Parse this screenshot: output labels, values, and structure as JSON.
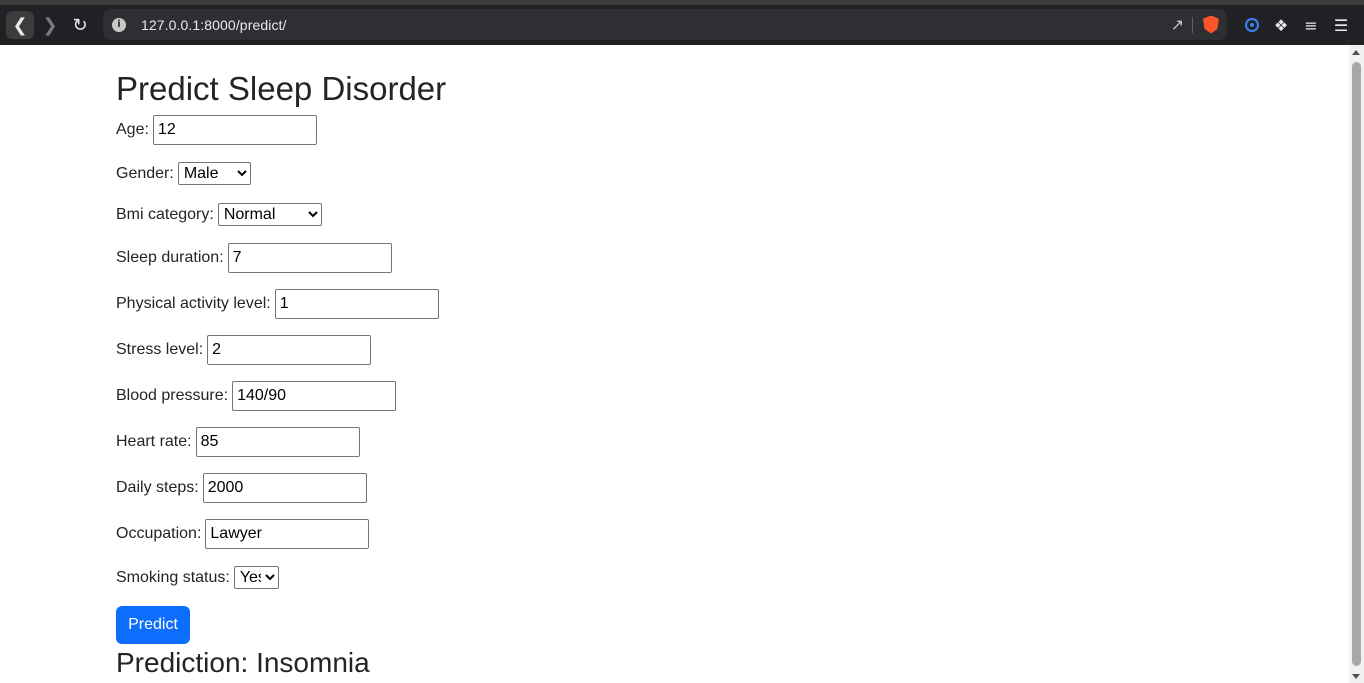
{
  "browser": {
    "url": "127.0.0.1:8000/predict/"
  },
  "page": {
    "title": "Predict Sleep Disorder"
  },
  "form": {
    "age": {
      "label": "Age:",
      "value": "12"
    },
    "gender": {
      "label": "Gender:",
      "selected": "Male"
    },
    "bmi_category": {
      "label": "Bmi category:",
      "selected": "Normal"
    },
    "sleep_duration": {
      "label": "Sleep duration:",
      "value": "7"
    },
    "physical_activity_level": {
      "label": "Physical activity level:",
      "value": "1"
    },
    "stress_level": {
      "label": "Stress level:",
      "value": "2"
    },
    "blood_pressure": {
      "label": "Blood pressure:",
      "value": "140/90"
    },
    "heart_rate": {
      "label": "Heart rate:",
      "value": "85"
    },
    "daily_steps": {
      "label": "Daily steps:",
      "value": "2000"
    },
    "occupation": {
      "label": "Occupation:",
      "value": "Lawyer"
    },
    "smoking_status": {
      "label": "Smoking status:",
      "selected": "Yes"
    },
    "submit_label": "Predict"
  },
  "result": {
    "text": "Prediction: Insomnia"
  },
  "colors": {
    "button_primary": "#0d6efd",
    "chrome_bg": "#202124",
    "text": "#212529"
  }
}
